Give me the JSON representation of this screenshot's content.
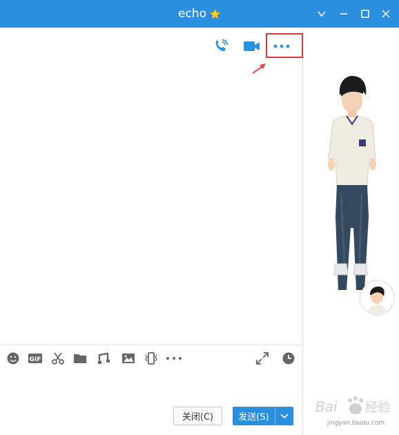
{
  "window": {
    "title": "echo",
    "accent_color": "#2b8fe0",
    "controls": [
      "chevron-down-icon",
      "minimize-icon",
      "maximize-icon",
      "close-icon"
    ]
  },
  "header_actions": [
    {
      "name": "voice-call",
      "icon": "phone-icon"
    },
    {
      "name": "video-call",
      "icon": "video-camera-icon"
    },
    {
      "name": "more",
      "icon": "more-dots-icon"
    }
  ],
  "toolbar": {
    "icons": [
      "emoji-icon",
      "gif-icon",
      "scissors-icon",
      "folder-icon",
      "music-icon",
      "image-icon",
      "shake-icon",
      "more-dots-icon"
    ],
    "right_icons": [
      "expand-icon",
      "history-clock-icon"
    ]
  },
  "buttons": {
    "close_label": "关闭(C)",
    "send_label": "发送(S)"
  },
  "watermark": {
    "text": "Baidu 经验",
    "url_text": "jingyan.baidu.com"
  }
}
